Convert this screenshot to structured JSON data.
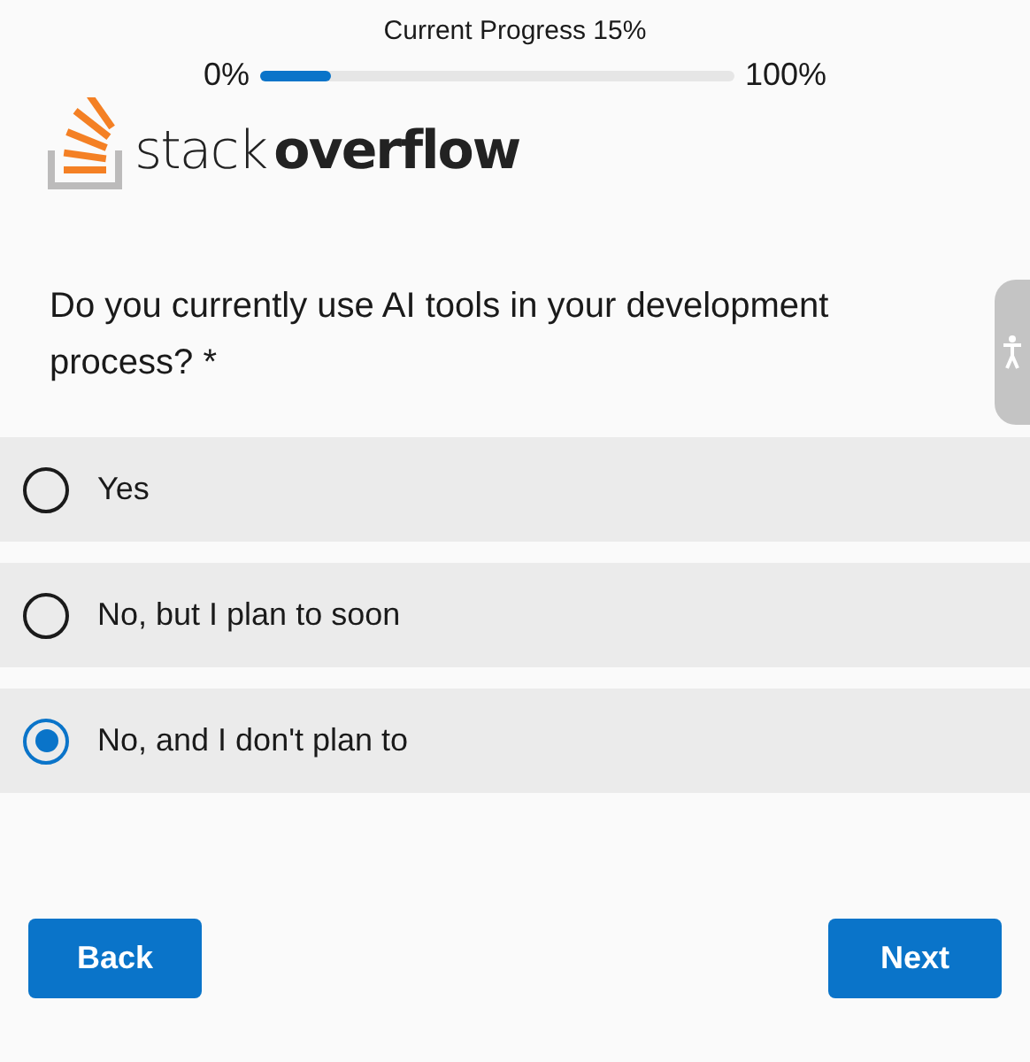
{
  "progress": {
    "title": "Current Progress 15%",
    "start_label": "0%",
    "end_label": "100%",
    "level": 0.15
  },
  "logo": {
    "word_1": "stack",
    "word_2": "overflow"
  },
  "question": "Do you currently use AI tools in your development process? *",
  "options": [
    {
      "label": "Yes",
      "selected": false
    },
    {
      "label": "No, but I plan to soon",
      "selected": false
    },
    {
      "label": "No, and I don't plan to",
      "selected": true
    }
  ],
  "buttons": {
    "back": "Back",
    "next": "Next"
  }
}
